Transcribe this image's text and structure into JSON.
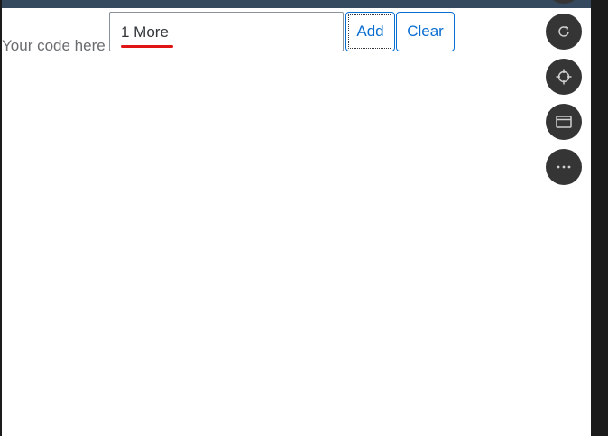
{
  "form": {
    "label": "Your code here",
    "input_value": "1 More",
    "add_label": "Add",
    "clear_label": "Clear"
  },
  "floating_toolbar": {
    "icons": [
      "refresh-icon",
      "crosshair-icon",
      "window-icon",
      "more-icon"
    ]
  },
  "colors": {
    "header_bar": "#354a5f",
    "button_accent": "#0a6ed1",
    "fab_background": "#353535",
    "annotation_underline": "#e01414"
  }
}
